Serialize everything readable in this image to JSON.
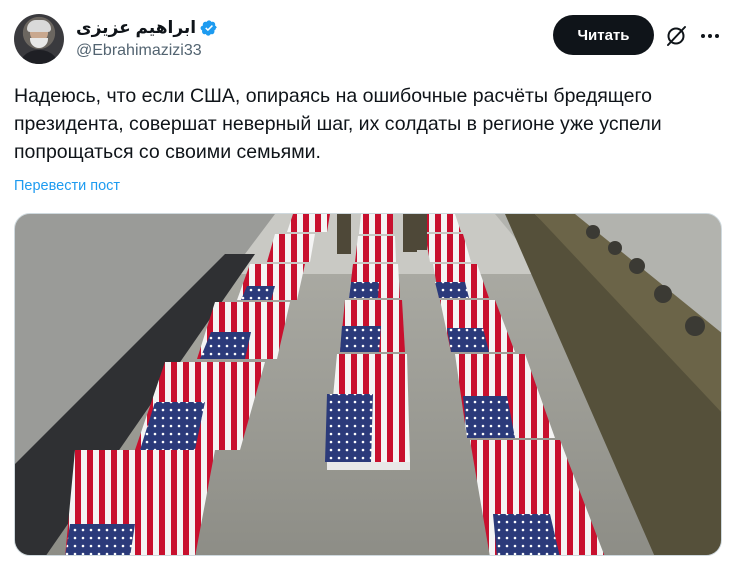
{
  "author": {
    "display_name": "ابراهیم عزیزی",
    "handle": "@Ebrahimazizi33",
    "verified": true,
    "avatar_icon": "avatar-portrait"
  },
  "actions": {
    "follow_label": "Читать",
    "grok_icon": "grok-icon",
    "more_icon": "more-icon"
  },
  "tweet": {
    "text_lines": [
      "Надеюсь, что если США, опираясь на ошибочные расчёты бредящего",
      "президента, совершат неверный шаг, их солдаты в регионе уже успели",
      "попрощаться со своими семьями."
    ],
    "translate_label": "Перевести пост"
  },
  "colors": {
    "text": "#0f1419",
    "secondary": "#536471",
    "link": "#1d9bf0",
    "follow_bg": "#0f1419",
    "flag_red": "#c8102e",
    "flag_blue": "#2b3a7a"
  },
  "media": {
    "type": "photo",
    "subject": "flag-draped-coffins"
  }
}
